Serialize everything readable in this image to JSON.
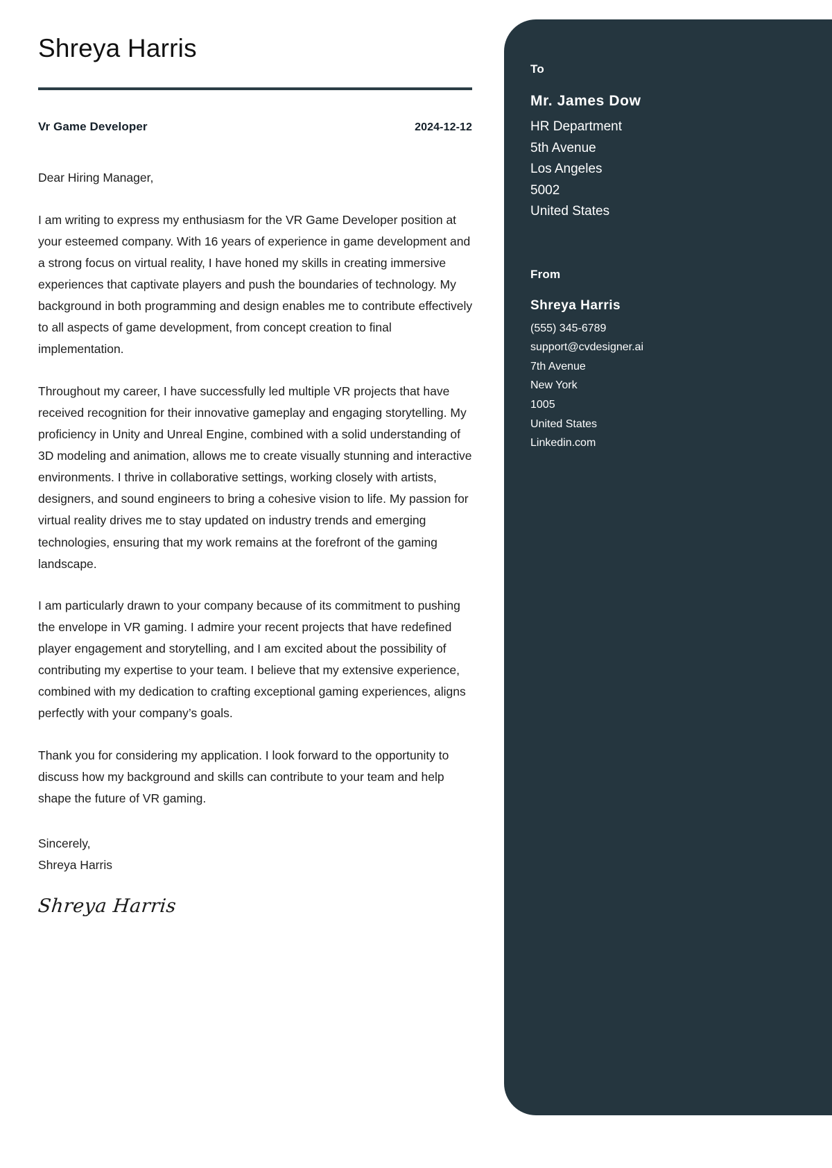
{
  "document": {
    "sender_name": "Shreya Harris",
    "job_title": "Vr Game Developer",
    "date": "2024-12-12",
    "salutation": "Dear Hiring Manager,",
    "paragraphs": [
      "I am writing to express my enthusiasm for the VR Game Developer position at your esteemed company. With 16 years of experience in game development and a strong focus on virtual reality, I have honed my skills in creating immersive experiences that captivate players and push the boundaries of technology. My background in both programming and design enables me to contribute effectively to all aspects of game development, from concept creation to final implementation.",
      "Throughout my career, I have successfully led multiple VR projects that have received recognition for their innovative gameplay and engaging storytelling. My proficiency in Unity and Unreal Engine, combined with a solid understanding of 3D modeling and animation, allows me to create visually stunning and interactive environments. I thrive in collaborative settings, working closely with artists, designers, and sound engineers to bring a cohesive vision to life. My passion for virtual reality drives me to stay updated on industry trends and emerging technologies, ensuring that my work remains at the forefront of the gaming landscape.",
      "I am particularly drawn to your company because of its commitment to pushing the envelope in VR gaming. I admire your recent projects that have redefined player engagement and storytelling, and I am excited about the possibility of contributing my expertise to your team. I believe that my extensive experience, combined with my dedication to crafting exceptional gaming experiences, aligns perfectly with your company’s goals.",
      "Thank you for considering my application. I look forward to the opportunity to discuss how my background and skills can contribute to your team and help shape the future of VR gaming."
    ],
    "closing_word": "Sincerely,",
    "closing_name": "Shreya Harris",
    "signature_text": "Shreya Harris"
  },
  "sidebar": {
    "to_heading": "To",
    "recipient": {
      "name": "Mr. James Dow",
      "lines": [
        "HR Department",
        "5th Avenue",
        "Los Angeles",
        "5002",
        "United States"
      ]
    },
    "from_heading": "From",
    "sender": {
      "name": "Shreya Harris",
      "lines": [
        "(555) 345-6789",
        "support@cvdesigner.ai",
        "7th Avenue",
        "New York",
        "1005",
        "United States",
        "Linkedin.com"
      ]
    }
  },
  "colors": {
    "sidebar_bg": "#25363f",
    "rule": "#2b3d46",
    "text": "#1d1d1d",
    "page_bg": "#ffffff"
  }
}
